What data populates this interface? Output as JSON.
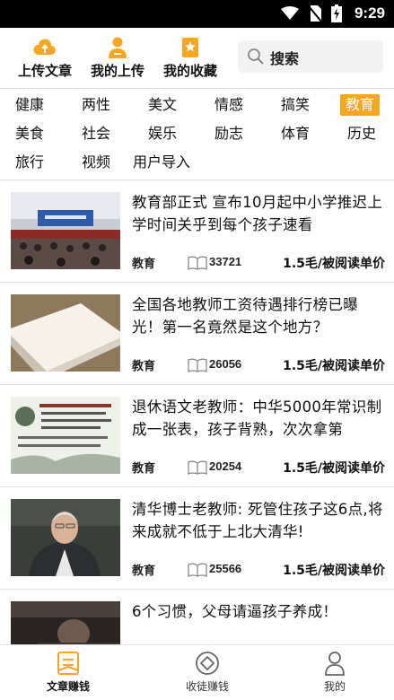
{
  "status_bar": {
    "time": "9:29"
  },
  "toolbar": {
    "upload_label": "上传文章",
    "my_uploads_label": "我的上传",
    "favorites_label": "我的收藏",
    "search_placeholder": "搜索"
  },
  "categories": [
    "健康",
    "两性",
    "美文",
    "情感",
    "搞笑",
    "教育",
    "美食",
    "社会",
    "娱乐",
    "励志",
    "体育",
    "历史",
    "旅行",
    "视频",
    "用户导入"
  ],
  "active_category": "教育",
  "articles": [
    {
      "title": "教育部正式 宣布10月起中小学推迟上学时间关乎到每个孩子速看",
      "tag": "教育",
      "reads": "33721",
      "price": "1.5毛/被阅读单价"
    },
    {
      "title": "全国各地教师工资待遇排行榜已曝光！第一名竟然是这个地方？",
      "tag": "教育",
      "reads": "26056",
      "price": "1.5毛/被阅读单价"
    },
    {
      "title": "退休语文老教师：中华5000年常识制成一张表，孩子背熟，次次拿第",
      "tag": "教育",
      "reads": "20254",
      "price": "1.5毛/被阅读单价"
    },
    {
      "title": "清华博士老教师: 死管住孩子这6点,将来成就不低于上北大清华!",
      "tag": "教育",
      "reads": "25566",
      "price": "1.5毛/被阅读单价"
    },
    {
      "title": "6个习惯，父母请逼孩子养成！",
      "tag": "",
      "reads": "",
      "price": ""
    }
  ],
  "bottom_nav": {
    "home_label": "文章赚钱",
    "invite_label": "收徒赚钱",
    "me_label": "我的"
  },
  "colors": {
    "accent": "#f5a623",
    "status_bar": "#000000"
  }
}
